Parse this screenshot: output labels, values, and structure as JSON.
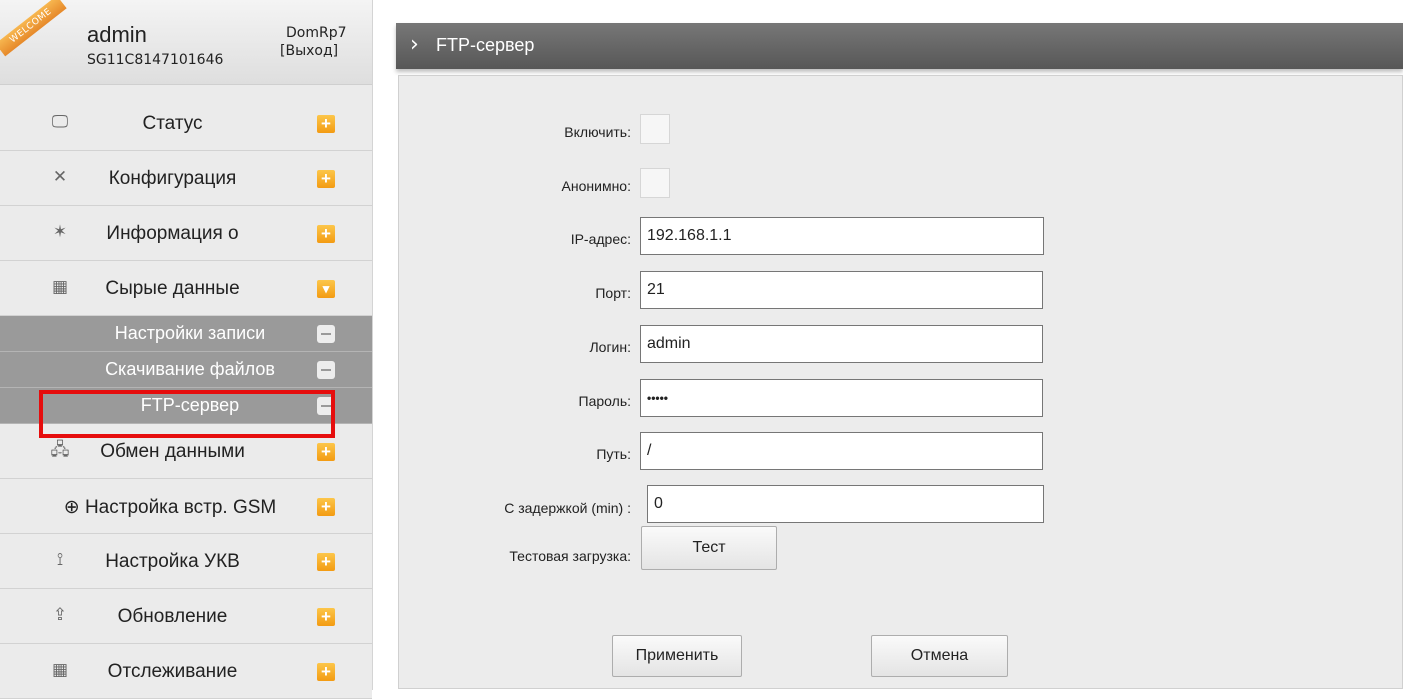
{
  "user": {
    "welcome_badge": "WELCOME",
    "name": "admin",
    "serial": "SG11C8147101646",
    "device": "DomRp7",
    "logout": "[Выход]"
  },
  "menu": {
    "items": [
      {
        "label": "Статус",
        "icon": "monitor-icon",
        "toggle": "+"
      },
      {
        "label": "Конфигурация",
        "icon": "tools-icon",
        "toggle": "+"
      },
      {
        "label": "Информация о",
        "icon": "satellite-icon",
        "toggle": "+"
      },
      {
        "label": "Сырые данные",
        "icon": "calendar-icon",
        "toggle": "▾"
      }
    ],
    "sub_items": [
      {
        "label": "Настройки записи"
      },
      {
        "label": "Скачивание файлов"
      },
      {
        "label": "FTP-сервер"
      }
    ],
    "items_after": [
      {
        "label": "Обмен данными",
        "icon": "network-icon",
        "toggle": "+"
      },
      {
        "label": "⊕ Настройка встр. GSM",
        "icon": "globe-icon",
        "toggle": "+"
      },
      {
        "label": "Настройка УКВ",
        "icon": "antenna-icon",
        "toggle": "+"
      },
      {
        "label": "Обновление",
        "icon": "upload-icon",
        "toggle": "+"
      },
      {
        "label": "Отслеживание",
        "icon": "calendar-icon",
        "toggle": "+"
      }
    ]
  },
  "page": {
    "title": "FTP-сервер"
  },
  "form": {
    "enable_label": "Включить:",
    "anonymous_label": "Анонимно:",
    "ip_label": "IP-адрес:",
    "ip_value": "192.168.1.1",
    "port_label": "Порт:",
    "port_value": "21",
    "login_label": "Логин:",
    "login_value": "admin",
    "password_label": "Пароль:",
    "password_value": "•••••",
    "path_label": "Путь:",
    "path_value": "/",
    "delay_label": "С задержкой (min) :",
    "delay_value": "0",
    "test_upload_label": "Тестовая загрузка:",
    "test_button": "Тест",
    "apply_button": "Применить",
    "cancel_button": "Отмена"
  },
  "colors": {
    "accent_orange": "#f39b12",
    "highlight_red": "#e60d0d",
    "title_bar": "#666666"
  }
}
